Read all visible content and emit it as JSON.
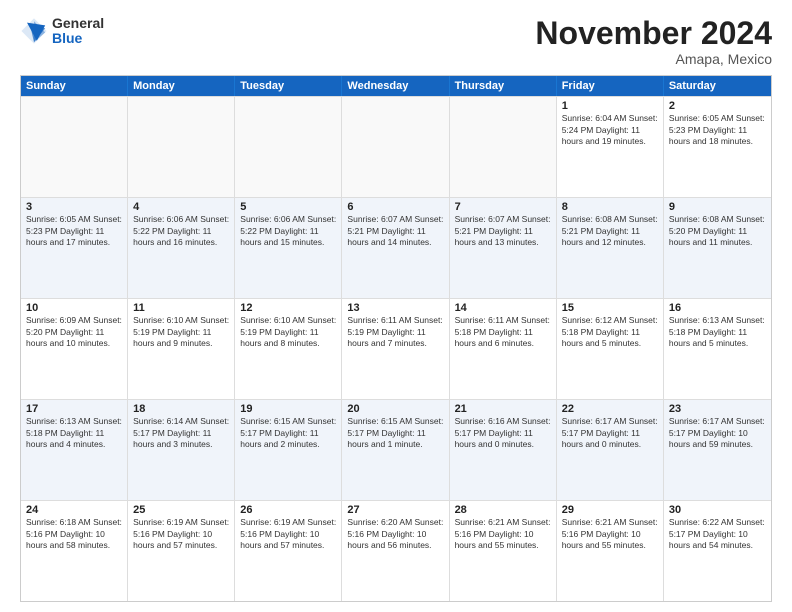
{
  "logo": {
    "general": "General",
    "blue": "Blue"
  },
  "title": "November 2024",
  "location": "Amapa, Mexico",
  "header": {
    "days": [
      "Sunday",
      "Monday",
      "Tuesday",
      "Wednesday",
      "Thursday",
      "Friday",
      "Saturday"
    ]
  },
  "rows": [
    [
      {
        "day": "",
        "info": "",
        "empty": true
      },
      {
        "day": "",
        "info": "",
        "empty": true
      },
      {
        "day": "",
        "info": "",
        "empty": true
      },
      {
        "day": "",
        "info": "",
        "empty": true
      },
      {
        "day": "",
        "info": "",
        "empty": true
      },
      {
        "day": "1",
        "info": "Sunrise: 6:04 AM\nSunset: 5:24 PM\nDaylight: 11 hours and 19 minutes."
      },
      {
        "day": "2",
        "info": "Sunrise: 6:05 AM\nSunset: 5:23 PM\nDaylight: 11 hours and 18 minutes."
      }
    ],
    [
      {
        "day": "3",
        "info": "Sunrise: 6:05 AM\nSunset: 5:23 PM\nDaylight: 11 hours and 17 minutes."
      },
      {
        "day": "4",
        "info": "Sunrise: 6:06 AM\nSunset: 5:22 PM\nDaylight: 11 hours and 16 minutes."
      },
      {
        "day": "5",
        "info": "Sunrise: 6:06 AM\nSunset: 5:22 PM\nDaylight: 11 hours and 15 minutes."
      },
      {
        "day": "6",
        "info": "Sunrise: 6:07 AM\nSunset: 5:21 PM\nDaylight: 11 hours and 14 minutes."
      },
      {
        "day": "7",
        "info": "Sunrise: 6:07 AM\nSunset: 5:21 PM\nDaylight: 11 hours and 13 minutes."
      },
      {
        "day": "8",
        "info": "Sunrise: 6:08 AM\nSunset: 5:21 PM\nDaylight: 11 hours and 12 minutes."
      },
      {
        "day": "9",
        "info": "Sunrise: 6:08 AM\nSunset: 5:20 PM\nDaylight: 11 hours and 11 minutes."
      }
    ],
    [
      {
        "day": "10",
        "info": "Sunrise: 6:09 AM\nSunset: 5:20 PM\nDaylight: 11 hours and 10 minutes."
      },
      {
        "day": "11",
        "info": "Sunrise: 6:10 AM\nSunset: 5:19 PM\nDaylight: 11 hours and 9 minutes."
      },
      {
        "day": "12",
        "info": "Sunrise: 6:10 AM\nSunset: 5:19 PM\nDaylight: 11 hours and 8 minutes."
      },
      {
        "day": "13",
        "info": "Sunrise: 6:11 AM\nSunset: 5:19 PM\nDaylight: 11 hours and 7 minutes."
      },
      {
        "day": "14",
        "info": "Sunrise: 6:11 AM\nSunset: 5:18 PM\nDaylight: 11 hours and 6 minutes."
      },
      {
        "day": "15",
        "info": "Sunrise: 6:12 AM\nSunset: 5:18 PM\nDaylight: 11 hours and 5 minutes."
      },
      {
        "day": "16",
        "info": "Sunrise: 6:13 AM\nSunset: 5:18 PM\nDaylight: 11 hours and 5 minutes."
      }
    ],
    [
      {
        "day": "17",
        "info": "Sunrise: 6:13 AM\nSunset: 5:18 PM\nDaylight: 11 hours and 4 minutes."
      },
      {
        "day": "18",
        "info": "Sunrise: 6:14 AM\nSunset: 5:17 PM\nDaylight: 11 hours and 3 minutes."
      },
      {
        "day": "19",
        "info": "Sunrise: 6:15 AM\nSunset: 5:17 PM\nDaylight: 11 hours and 2 minutes."
      },
      {
        "day": "20",
        "info": "Sunrise: 6:15 AM\nSunset: 5:17 PM\nDaylight: 11 hours and 1 minute."
      },
      {
        "day": "21",
        "info": "Sunrise: 6:16 AM\nSunset: 5:17 PM\nDaylight: 11 hours and 0 minutes."
      },
      {
        "day": "22",
        "info": "Sunrise: 6:17 AM\nSunset: 5:17 PM\nDaylight: 11 hours and 0 minutes."
      },
      {
        "day": "23",
        "info": "Sunrise: 6:17 AM\nSunset: 5:17 PM\nDaylight: 10 hours and 59 minutes."
      }
    ],
    [
      {
        "day": "24",
        "info": "Sunrise: 6:18 AM\nSunset: 5:16 PM\nDaylight: 10 hours and 58 minutes."
      },
      {
        "day": "25",
        "info": "Sunrise: 6:19 AM\nSunset: 5:16 PM\nDaylight: 10 hours and 57 minutes."
      },
      {
        "day": "26",
        "info": "Sunrise: 6:19 AM\nSunset: 5:16 PM\nDaylight: 10 hours and 57 minutes."
      },
      {
        "day": "27",
        "info": "Sunrise: 6:20 AM\nSunset: 5:16 PM\nDaylight: 10 hours and 56 minutes."
      },
      {
        "day": "28",
        "info": "Sunrise: 6:21 AM\nSunset: 5:16 PM\nDaylight: 10 hours and 55 minutes."
      },
      {
        "day": "29",
        "info": "Sunrise: 6:21 AM\nSunset: 5:16 PM\nDaylight: 10 hours and 55 minutes."
      },
      {
        "day": "30",
        "info": "Sunrise: 6:22 AM\nSunset: 5:17 PM\nDaylight: 10 hours and 54 minutes."
      }
    ]
  ]
}
